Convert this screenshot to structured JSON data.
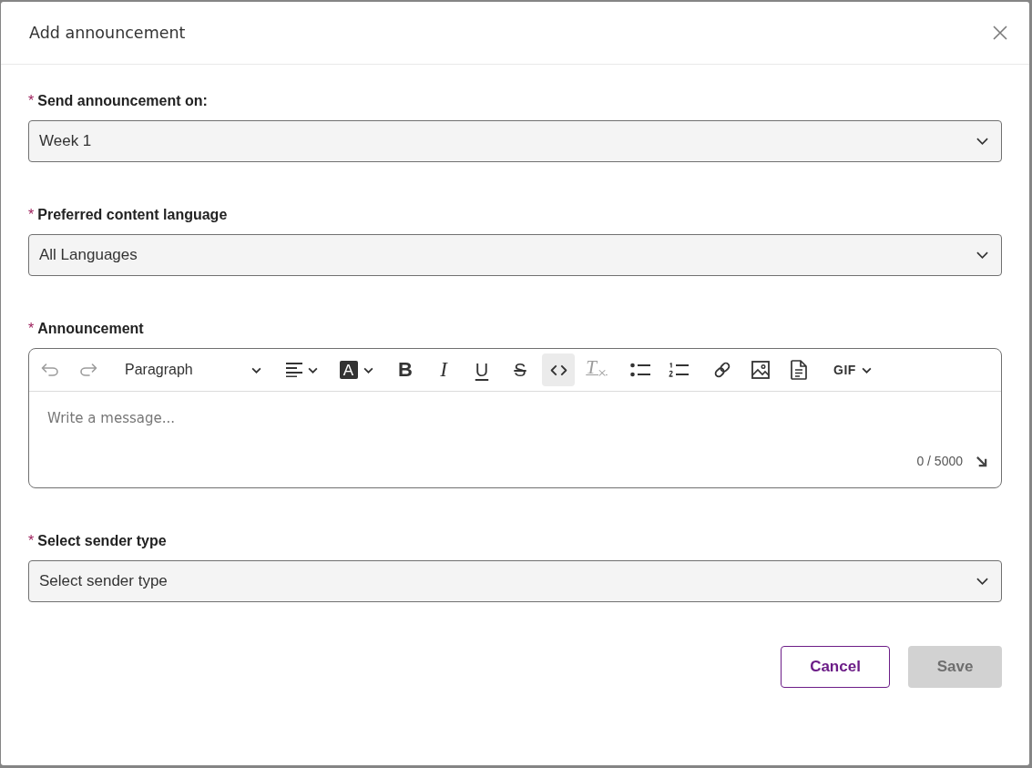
{
  "dialog": {
    "title": "Add announcement"
  },
  "fields": [
    {
      "kind": "select",
      "required_mark": "*",
      "label": "Send announcement on:",
      "value": "Week 1"
    },
    {
      "kind": "select",
      "required_mark": "*",
      "label": "Preferred content language",
      "value": "All Languages"
    },
    {
      "kind": "editor",
      "required_mark": "*",
      "label": "Announcement",
      "toolbar": [
        {
          "kind": "undo",
          "disabled": true,
          "selected": false
        },
        {
          "kind": "redo",
          "disabled": true,
          "selected": false
        },
        {
          "kind": "block_format",
          "label": "Paragraph",
          "disabled": false,
          "selected": false
        },
        {
          "kind": "align",
          "disabled": false,
          "selected": false
        },
        {
          "kind": "text_color",
          "label": "A",
          "disabled": false,
          "selected": false
        },
        {
          "kind": "bold",
          "label": "B",
          "disabled": false,
          "selected": false
        },
        {
          "kind": "italic",
          "label": "I",
          "disabled": false,
          "selected": false
        },
        {
          "kind": "underline",
          "label": "U",
          "disabled": false,
          "selected": false
        },
        {
          "kind": "strikethrough",
          "label": "S",
          "disabled": false,
          "selected": false
        },
        {
          "kind": "code",
          "disabled": false,
          "selected": true
        },
        {
          "kind": "clear_format",
          "label": "T$_{×}$",
          "disabled": true,
          "selected": false
        },
        {
          "kind": "bulleted_list",
          "disabled": false,
          "selected": false
        },
        {
          "kind": "numbered_list",
          "disabled": false,
          "selected": false
        },
        {
          "kind": "link",
          "disabled": false,
          "selected": false
        },
        {
          "kind": "image",
          "disabled": false,
          "selected": false
        },
        {
          "kind": "document",
          "disabled": false,
          "selected": false
        },
        {
          "kind": "gif",
          "label": "GIF",
          "disabled": false,
          "selected": false
        }
      ],
      "placeholder": "Write a message...",
      "counter": "0 / 5000"
    },
    {
      "kind": "select",
      "required_mark": "*",
      "label": "Select sender type",
      "value": "Select sender type"
    }
  ],
  "buttons": [
    {
      "kind": "secondary",
      "label": "Cancel",
      "disabled": false
    },
    {
      "kind": "primary",
      "label": "Save",
      "disabled": true
    }
  ]
}
